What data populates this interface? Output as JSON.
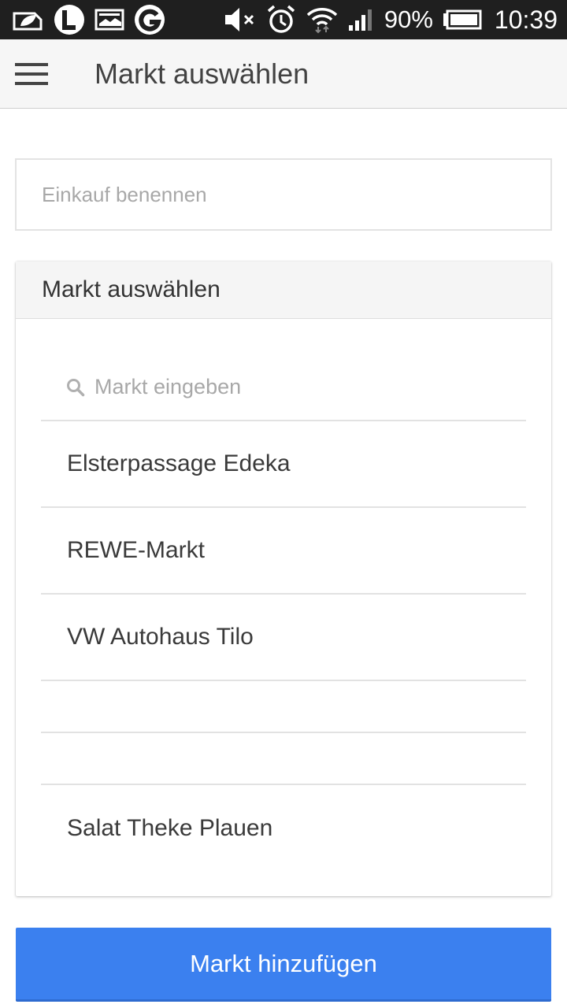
{
  "status_bar": {
    "battery_percent": "90%",
    "time": "10:39",
    "icons": [
      "leaf-notification-icon",
      "l-app-icon",
      "image-notification-icon",
      "google-icon",
      "mute-icon",
      "alarm-icon",
      "wifi-icon",
      "signal-icon",
      "battery-icon"
    ]
  },
  "app_bar": {
    "title": "Markt auswählen"
  },
  "name_field": {
    "placeholder": "Einkauf benennen"
  },
  "market_card": {
    "header": "Markt auswählen",
    "search_placeholder": "Markt eingeben",
    "items": [
      "Elsterpassage Edeka",
      "REWE-Markt",
      "VW Autohaus Tilo",
      "",
      "",
      "Salat Theke Plauen"
    ]
  },
  "add_button": {
    "label": "Markt hinzufügen"
  },
  "colors": {
    "accent": "#3b80ef",
    "status_bar": "#1f1f1f",
    "app_bar": "#f6f6f6"
  }
}
